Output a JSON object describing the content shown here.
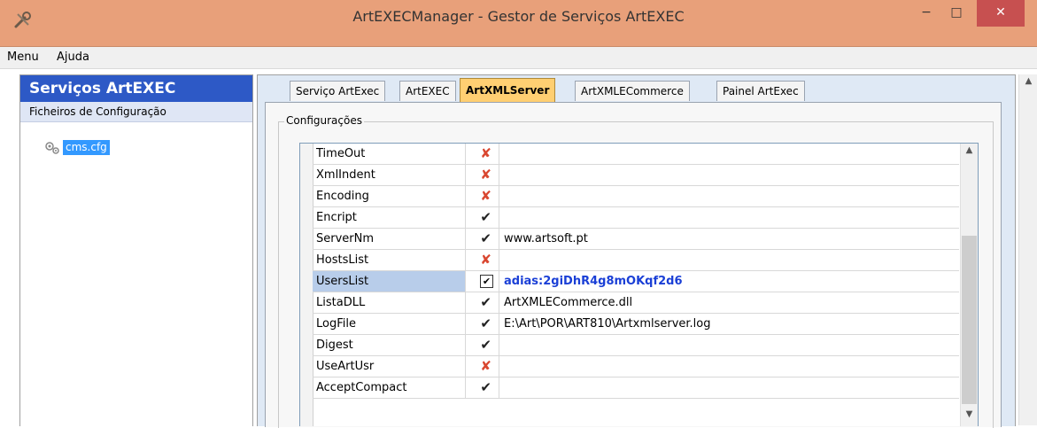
{
  "window": {
    "title": "ArtEXECManager - Gestor de Serviços ArtEXEC",
    "minimize": "−",
    "maximize": "□",
    "close": "✕"
  },
  "menu": {
    "items": [
      "Menu",
      "Ajuda"
    ]
  },
  "sidebar": {
    "header": "Serviços ArtEXEC",
    "subheader": "Ficheiros de Configuração",
    "tree_item": "cms.cfg",
    "tree_icon": "gears-icon"
  },
  "tabs": [
    {
      "label": "Serviço ArtExec"
    },
    {
      "label": "ArtEXEC"
    },
    {
      "label": "ArtXMLServer"
    },
    {
      "label": "ArtXMLECommerce"
    },
    {
      "label": "Painel ArtExec"
    }
  ],
  "active_tab": "ArtXMLServer",
  "group": {
    "title": "Configurações"
  },
  "grid": {
    "rows": [
      {
        "name": "TimeOut",
        "flag": "✘",
        "value": ""
      },
      {
        "name": "XmlIndent",
        "flag": "✘",
        "value": ""
      },
      {
        "name": "Encoding",
        "flag": "✘",
        "value": ""
      },
      {
        "name": "Encript",
        "flag": "✔",
        "value": ""
      },
      {
        "name": "ServerNm",
        "flag": "✔",
        "value": "www.artsoft.pt"
      },
      {
        "name": "HostsList",
        "flag": "✘",
        "value": ""
      },
      {
        "name": "UsersList",
        "flag": "✔",
        "value": "adias:2giDhR4g8mOKqf2d6"
      },
      {
        "name": "ListaDLL",
        "flag": "✔",
        "value": "ArtXMLECommerce.dll"
      },
      {
        "name": "LogFile",
        "flag": "✔",
        "value": "E:\\Art\\POR\\ART810\\Artxmlserver.log"
      },
      {
        "name": "Digest",
        "flag": "✔",
        "value": ""
      },
      {
        "name": "UseArtUsr",
        "flag": "✘",
        "value": ""
      },
      {
        "name": "AcceptCompact",
        "flag": "✔",
        "value": ""
      }
    ],
    "selected_row": "UsersList"
  },
  "colors": {
    "titlebar": "#e8a07a",
    "sidebar_header": "#2d59c6",
    "active_tab": "#ffcf72",
    "selected_value": "#1a3fd6",
    "false_flag": "#d9462f"
  },
  "scroll": {
    "up": "▲",
    "down": "▼"
  }
}
